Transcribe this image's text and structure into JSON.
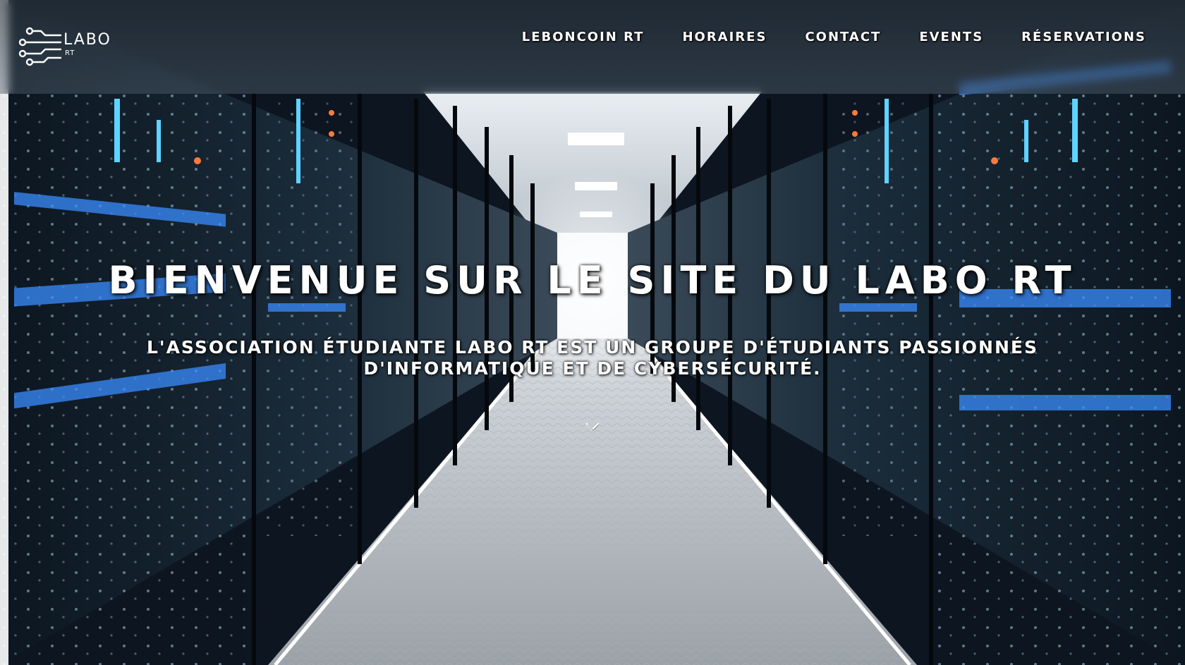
{
  "header": {
    "logo": {
      "title": "LABO",
      "subtitle": "RT",
      "icon": "circuit-icon"
    },
    "nav": [
      {
        "label": "LEBONCOIN RT"
      },
      {
        "label": "HORAIRES"
      },
      {
        "label": "CONTACT"
      },
      {
        "label": "EVENTS"
      },
      {
        "label": "RÉSERVATIONS"
      }
    ]
  },
  "hero": {
    "title": "BIENVENUE SUR LE SITE DU LABO RT",
    "subtitle": "L'ASSOCIATION ÉTUDIANTE LABO RT EST UN GROUPE D'ÉTUDIANTS PASSIONNÉS D'INFORMATIQUE ET DE CYBERSÉCURITÉ.",
    "scroll_icon": "chevron-down-icon",
    "background": "server-room-corridor"
  },
  "colors": {
    "text": "#ffffff",
    "server_blue": "#3a8cff",
    "server_led_orange": "#ff7a3a",
    "corridor_floor": "#bfc4c9"
  }
}
